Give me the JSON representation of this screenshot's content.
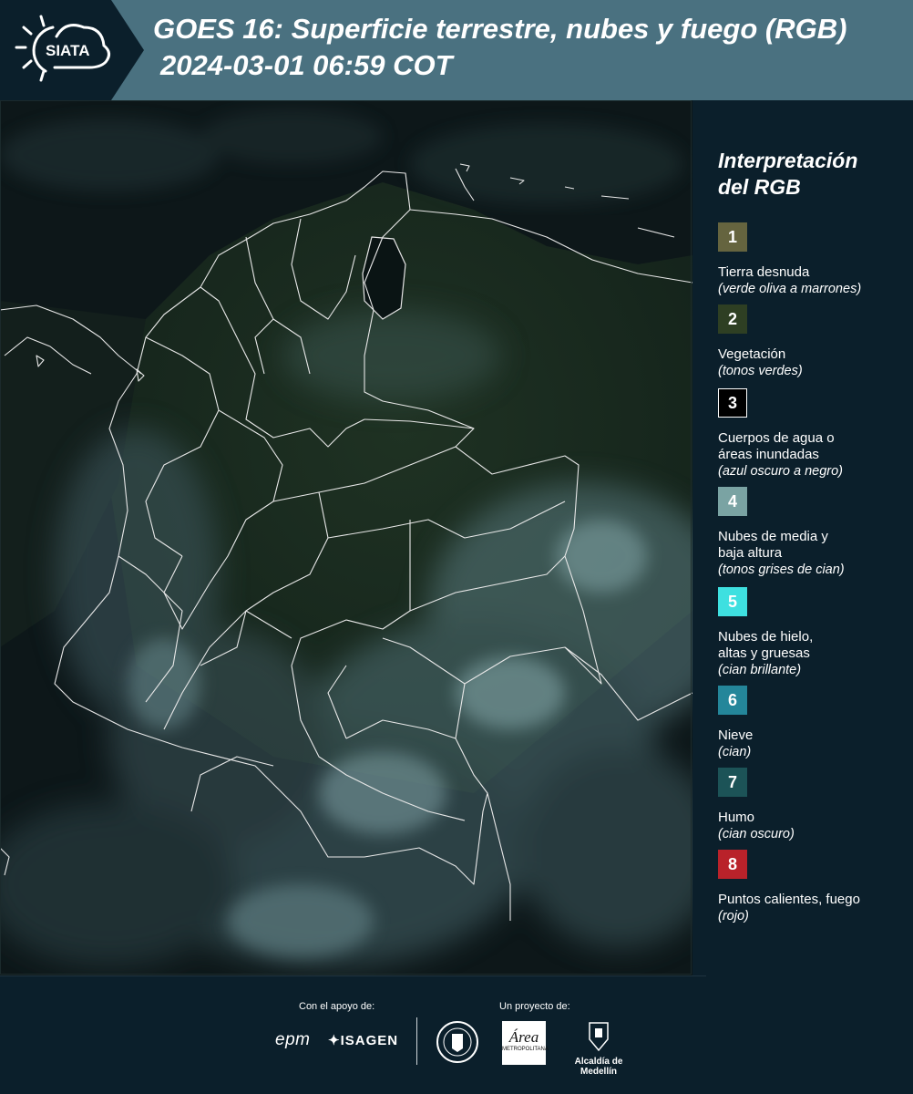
{
  "header": {
    "logo_text": "SIATA",
    "title_line1": "GOES 16: Superficie terrestre, nubes y fuego (RGB)",
    "title_line2": "2024-03-01 06:59 COT",
    "bg_color": "#4a7180",
    "logo_bg_color": "#0b1f2b"
  },
  "legend": {
    "title_line1": "Interpretación",
    "title_line2": "del RGB",
    "items": [
      {
        "number": "1",
        "label_lines": [
          "Tierra desnuda"
        ],
        "description": "(verde oliva a marrones)",
        "color": "#65643f"
      },
      {
        "number": "2",
        "label_lines": [
          "Vegetación"
        ],
        "description": "(tonos verdes)",
        "color": "#2e3f23"
      },
      {
        "number": "3",
        "label_lines": [
          "Cuerpos de agua o",
          "áreas inundadas"
        ],
        "description": "(azul oscuro a negro)",
        "color": "#000000"
      },
      {
        "number": "4",
        "label_lines": [
          "Nubes de media y",
          "baja altura"
        ],
        "description": "(tonos grises de cian)",
        "color": "#7aa3a3"
      },
      {
        "number": "5",
        "label_lines": [
          "Nubes de hielo,",
          "altas y gruesas"
        ],
        "description": "(cian brillante)",
        "color": "#3ee0e0"
      },
      {
        "number": "6",
        "label_lines": [
          "Nieve"
        ],
        "description": "(cian)",
        "color": "#24869a"
      },
      {
        "number": "7",
        "label_lines": [
          "Humo"
        ],
        "description": "(cian oscuro)",
        "color": "#1c5357"
      },
      {
        "number": "8",
        "label_lines": [
          "Puntos calientes, fuego"
        ],
        "description": "(rojo)",
        "color": "#b9222a"
      }
    ]
  },
  "footer": {
    "support_caption": "Con el apoyo de:",
    "project_caption": "Un proyecto de:",
    "sponsors": [
      "epm",
      "ISAGEN"
    ],
    "partners": [
      "Área Metropolitana Valle de Aburrá",
      "Alcaldía de Medellín"
    ],
    "partner_logo_text": "Área",
    "partner_logo_subtext": "METROPOLITANA",
    "alcaldia_text": "Alcaldía de Medellín",
    "bg_color": "#0b1f2b"
  }
}
